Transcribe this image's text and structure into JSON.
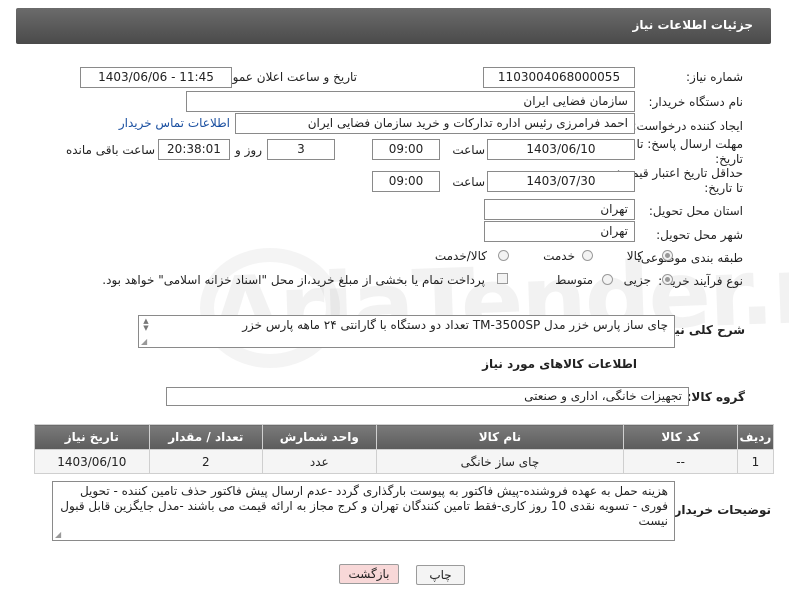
{
  "header": {
    "title": "جزئیات اطلاعات نیاز"
  },
  "form": {
    "need_number_label": "شماره نیاز:",
    "need_number": "1103004068000055",
    "announce_label": "تاریخ و ساعت اعلان عمومی:",
    "announce_value": "1403/06/06 - 11:45",
    "buyer_label": "نام دستگاه خریدار:",
    "buyer_value": "سازمان فضایی ایران",
    "creator_label": "ایجاد کننده درخواست:",
    "creator_value": "احمد فرامرزی رئیس اداره تدارکات و خرید سازمان فضایی ایران",
    "contact_link": "اطلاعات تماس خریدار",
    "deadline_label": "مهلت ارسال پاسخ: تا تاریخ:",
    "deadline_date": "1403/06/10",
    "hour_label": "ساعت",
    "deadline_time": "09:00",
    "days_value": "3",
    "days_label": "روز و",
    "remaining_time": "20:38:01",
    "remaining_label": "ساعت باقی مانده",
    "validity_label": "حداقل تاریخ اعتبار قیمت: تا تاریخ:",
    "validity_date": "1403/07/30",
    "validity_time": "09:00",
    "province_label": "استان محل تحویل:",
    "province_value": "تهران",
    "city_label": "شهر محل تحویل:",
    "city_value": "تهران",
    "category_label": "طبقه بندی موضوعی:",
    "category_options": [
      "کالا",
      "خدمت",
      "کالا/خدمت"
    ],
    "process_label": "نوع فرآیند خرید :",
    "process_options": [
      "جزیی",
      "متوسط"
    ],
    "payment_note": "پرداخت تمام یا بخشی از مبلغ خرید،از محل \"اسناد خزانه اسلامی\" خواهد بود.",
    "summary_label": "شرح کلی نیاز:",
    "summary_value": "چای ساز پارس خزر مدل TM-3500SP تعداد دو دستگاه با گارانتی ۲۴ ماهه پارس خزر",
    "goods_info_title": "اطلاعات کالاهای مورد نیاز",
    "goods_group_label": "گروه کالا:",
    "goods_group_value": "تجهیزات خانگی، اداری و صنعتی"
  },
  "table": {
    "headers": [
      "ردیف",
      "کد کالا",
      "نام کالا",
      "واحد شمارش",
      "تعداد / مقدار",
      "تاریخ نیاز"
    ],
    "rows": [
      [
        "1",
        "--",
        "چای ساز خانگی",
        "عدد",
        "2",
        "1403/06/10"
      ]
    ]
  },
  "buyer_notes": {
    "label": "توضیحات خریدار:",
    "value": "هزینه حمل به عهده فروشنده-پیش فاکتور به پیوست بارگذاری گردد -عدم ارسال پیش فاکتور حذف تامین کننده - تحویل فوری - تسویه نقدی 10 روز کاری-فقط تامین کنندگان تهران و کرج مجاز به ارائه قیمت می باشند -مدل جایگزین قابل قبول نیست"
  },
  "buttons": {
    "print": "چاپ",
    "back": "بازگشت"
  },
  "watermark": "AriaTender.neT",
  "colors": {
    "header_bg": "#555555",
    "link": "#1a4fa0",
    "back_button_bg": "#f8d8d8"
  }
}
